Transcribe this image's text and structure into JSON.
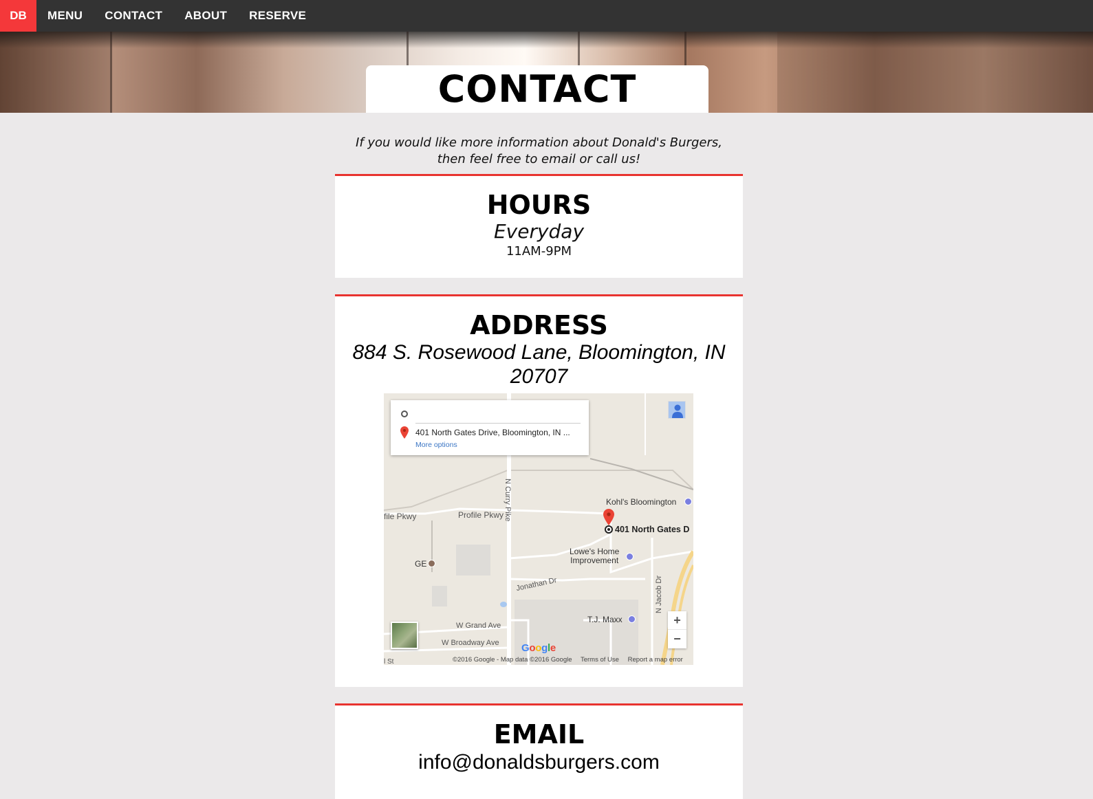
{
  "nav": {
    "logo": "DB",
    "items": [
      "MENU",
      "CONTACT",
      "ABOUT",
      "RESERVE"
    ]
  },
  "page": {
    "title": "CONTACT",
    "intro_line1": "If you would like more information about Donald's Burgers,",
    "intro_line2": "then feel free to email or call us!"
  },
  "hours": {
    "heading": "HOURS",
    "days": "Everyday",
    "time": "11AM-9PM"
  },
  "address": {
    "heading": "ADDRESS",
    "line1": "884 S. Rosewood Lane, Bloomington, IN",
    "line2": "20707"
  },
  "map": {
    "destination": "401 North Gates Drive, Bloomington, IN ...",
    "more_options": "More options",
    "labels": {
      "kohls": "Kohl's Bloomington",
      "marker": "401 North Gates D",
      "profile_left": "file Pkwy",
      "profile": "Profile Pkwy",
      "curry": "N Curry Pike",
      "lowes_1": "Lowe's Home",
      "lowes_2": "Improvement",
      "ge": "GE",
      "jonathan": "Jonathan Dr",
      "jacob": "N Jacob Dr",
      "tjmaxx": "T.J. Maxx",
      "grand": "W Grand Ave",
      "broadway": "W Broadway Ave",
      "st": "l St"
    },
    "zoom_in": "+",
    "zoom_out": "−",
    "google": "Google",
    "footer": {
      "copyright": "©2016 Google - Map data ©2016 Google",
      "terms": "Terms of Use",
      "report": "Report a map error"
    }
  },
  "email": {
    "heading": "EMAIL",
    "address": "info@donaldsburgers.com"
  },
  "colors": {
    "accent": "#e8332f",
    "nav_bg": "#333333",
    "page_bg": "#ebe9ea"
  }
}
